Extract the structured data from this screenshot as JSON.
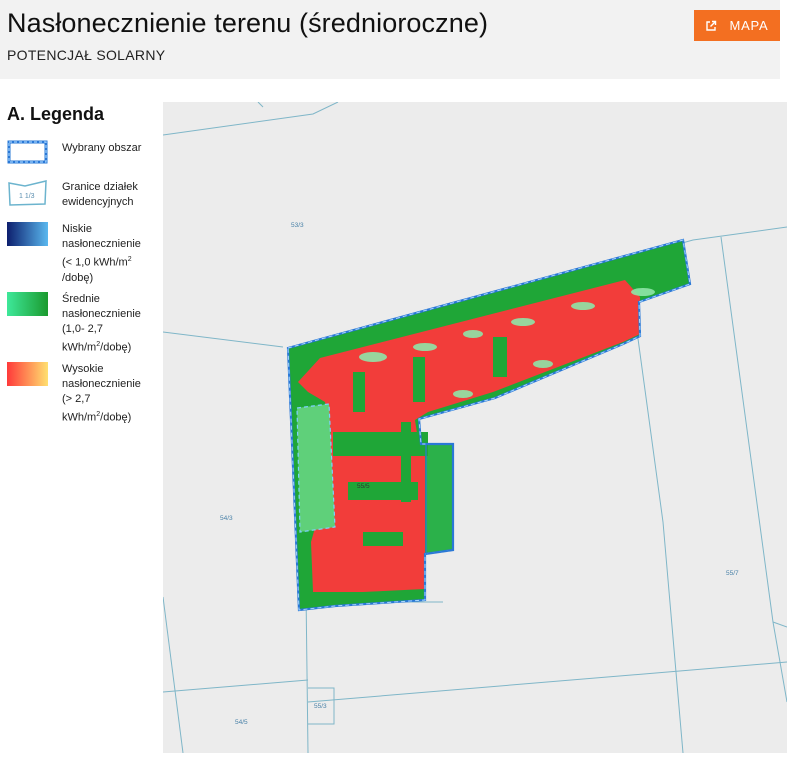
{
  "header": {
    "title": "Nasłonecznienie terenu (średnioroczne)",
    "subtitle": "POTENCJAŁ SOLARNY",
    "map_button_label": "MAPA",
    "map_button_icon": "external-link-icon"
  },
  "legend": {
    "title": "A. Legenda",
    "items": [
      {
        "key": "selected",
        "label": "Wybrany obszar"
      },
      {
        "key": "parcels",
        "label_lines": [
          "Granice działek",
          "ewidencyjnych"
        ],
        "swatch_text": "1 1/3"
      },
      {
        "key": "low",
        "label_lines": [
          "Niskie",
          "nasłonecznienie",
          "(< 1,0 kWh/m",
          "/dobę)"
        ],
        "sup": "2"
      },
      {
        "key": "medium",
        "label_lines": [
          "Średnie",
          "nasłonecznienie",
          "(1,0- 2,7",
          "kWh/m",
          "/dobę)"
        ],
        "sup": "2"
      },
      {
        "key": "high",
        "label_lines": [
          "Wysokie",
          "nasłonecznienie",
          "(> 2,7",
          "kWh/m",
          "/dobę)"
        ],
        "sup": "2"
      }
    ]
  },
  "map": {
    "parcel_labels": [
      "53/3",
      "55/5",
      "54/3",
      "55/7",
      "55/3",
      "54/5"
    ]
  },
  "colors": {
    "accent": "#f36f21",
    "selected_border": "#2a78d6",
    "parcel_line": "#7fb6c8",
    "low_from": "#0d1f6e",
    "low_to": "#5ab8ef",
    "medium_from": "#3ee89a",
    "medium_to": "#1b9a2e",
    "high_from": "#ff3a3a",
    "high_to": "#ffe070"
  }
}
